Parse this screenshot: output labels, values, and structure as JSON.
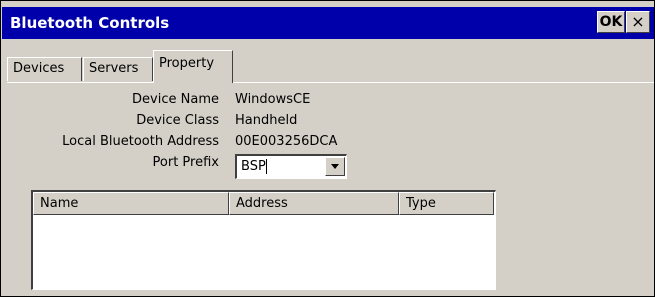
{
  "window": {
    "title": "Bluetooth Controls",
    "ok_label": "OK",
    "close_label": "×"
  },
  "tabs": [
    {
      "label": "Devices"
    },
    {
      "label": "Servers"
    },
    {
      "label": "Property",
      "selected": true
    }
  ],
  "property": {
    "device_name_label": "Device Name",
    "device_name_value": "WindowsCE",
    "device_class_label": "Device Class",
    "device_class_value": "Handheld",
    "address_label": "Local Bluetooth Address",
    "address_value": "00E003256DCA",
    "port_prefix_label": "Port Prefix",
    "port_prefix_value": "BSP"
  },
  "listview": {
    "columns": [
      "Name",
      "Address",
      "Type"
    ],
    "rows": []
  }
}
